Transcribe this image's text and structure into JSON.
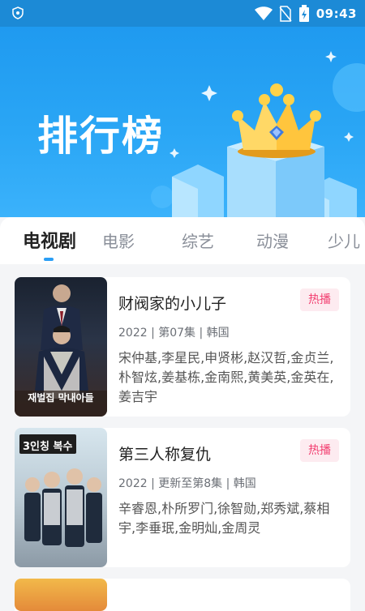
{
  "status_bar": {
    "time": "09:43",
    "icons": [
      "shield-icon",
      "wifi-icon",
      "no-sim-icon",
      "battery-icon"
    ]
  },
  "banner": {
    "title": "排行榜",
    "icon": "crown-icon"
  },
  "tabs": [
    {
      "label": "电视剧",
      "active": true
    },
    {
      "label": "电影",
      "active": false
    },
    {
      "label": "综艺",
      "active": false
    },
    {
      "label": "动漫",
      "active": false
    },
    {
      "label": "少儿",
      "active": false
    }
  ],
  "items": [
    {
      "title": "财阀家的小儿子",
      "badge": "热播",
      "meta": "2022 | 第07集 | 韩国",
      "cast": "宋仲基,李星民,申贤彬,赵汉哲,金贞兰,朴智炫,姜基栋,金南熙,黄美英,金英在,姜吉宇",
      "poster_text": "재벌집 막내아들"
    },
    {
      "title": "第三人称复仇",
      "badge": "热播",
      "meta": "2022 | 更新至第8集 | 韩国",
      "cast": "辛睿恩,朴所罗门,徐智勋,郑秀斌,蔡相宇,李垂珉,金明灿,金周灵",
      "poster_text": "3인칭 복수"
    }
  ],
  "colors": {
    "accent": "#2a9ef5",
    "status_bar": "#1c8ad6",
    "badge_text": "#f23d6f",
    "badge_bg": "#fdebf0"
  }
}
